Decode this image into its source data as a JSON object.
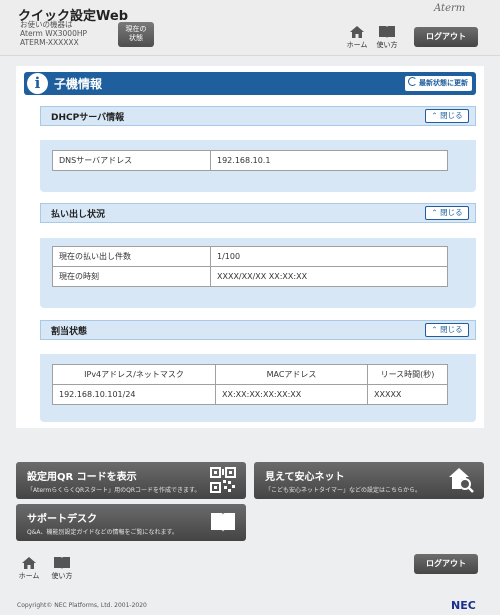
{
  "header": {
    "title": "クイック設定Web",
    "device_label": "お使いの機器は",
    "model": "Aterm WX3000HP",
    "device_name": "ATERM-XXXXXX",
    "status_button": [
      "現在の",
      "状態"
    ],
    "brand": "Aterm",
    "home_label": "ホーム",
    "usage_label": "使い方",
    "logout_label": "ログアウト"
  },
  "page": {
    "title": "子機情報",
    "refresh_label": "最新状態に更新"
  },
  "dhcp": {
    "title": "DHCPサーバ情報",
    "close_label": "閉じる",
    "rows": [
      {
        "label": "DNSサーバアドレス",
        "value": "192.168.10.1"
      }
    ]
  },
  "lease_status": {
    "title": "払い出し状況",
    "close_label": "閉じる",
    "rows": [
      {
        "label": "現在の払い出し件数",
        "value": "1/100"
      },
      {
        "label": "現在の時刻",
        "value": "XXXX/XX/XX XX:XX:XX"
      }
    ]
  },
  "assignment": {
    "title": "割当状態",
    "close_label": "閉じる",
    "columns": [
      "IPv4アドレス/ネットマスク",
      "MACアドレス",
      "リース時間(秒)"
    ],
    "rows": [
      [
        "192.168.10.101/24",
        "XX:XX:XX:XX:XX:XX",
        "XXXXX"
      ]
    ]
  },
  "tiles": {
    "qr": {
      "title": "設定用QR コードを表示",
      "desc": "「AtermらくらくQRスタート」用のQRコードを作成できます。",
      "icon": "qr-code-icon"
    },
    "safety": {
      "title": "見えて安心ネット",
      "desc": "「こども安心ネットタイマー」などの設定はこちらから。",
      "icon": "house-search-icon"
    },
    "support": {
      "title": "サポートデスク",
      "desc": "Q&A、機能別設定ガイドなどの情報をご覧になれます。",
      "icon": "book-icon"
    }
  },
  "footer": {
    "home_label": "ホーム",
    "usage_label": "使い方",
    "logout_label": "ログアウト",
    "copyright": "Copyright© NEC Platforms, Ltd. 2001-2020",
    "logo": "NEC"
  },
  "colors": {
    "accent": "#1f5f9e",
    "section_bg": "#d7e7f6",
    "button_dark": "#555555"
  }
}
